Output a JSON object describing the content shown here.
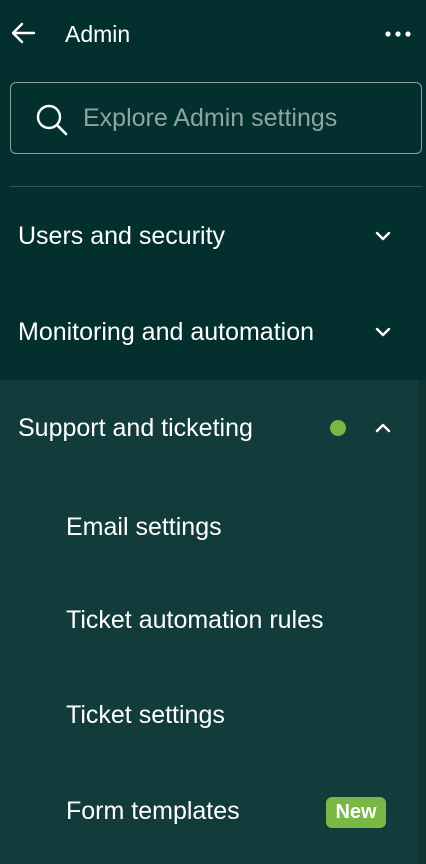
{
  "header": {
    "back_icon": "arrow-left-icon",
    "title": "Admin",
    "more_icon": "more-horizontal-icon"
  },
  "search": {
    "icon": "search-icon",
    "placeholder": "Explore Admin settings",
    "value": ""
  },
  "sections": [
    {
      "label": "Users and security",
      "expanded": false,
      "chevron_icon": "chevron-down-icon"
    },
    {
      "label": "Monitoring and automation",
      "expanded": false,
      "chevron_icon": "chevron-down-icon"
    },
    {
      "label": "Support and ticketing",
      "expanded": true,
      "has_indicator_dot": true,
      "chevron_icon": "chevron-up-icon"
    }
  ],
  "support_items": [
    {
      "label": "Email settings"
    },
    {
      "label": "Ticket automation rules"
    },
    {
      "label": "Ticket settings"
    },
    {
      "label": "Form templates",
      "badge": "New"
    }
  ],
  "colors": {
    "background": "#03302f",
    "expanded_background": "#123c3b",
    "accent_green": "#78b843",
    "placeholder": "#8fa3a1"
  }
}
